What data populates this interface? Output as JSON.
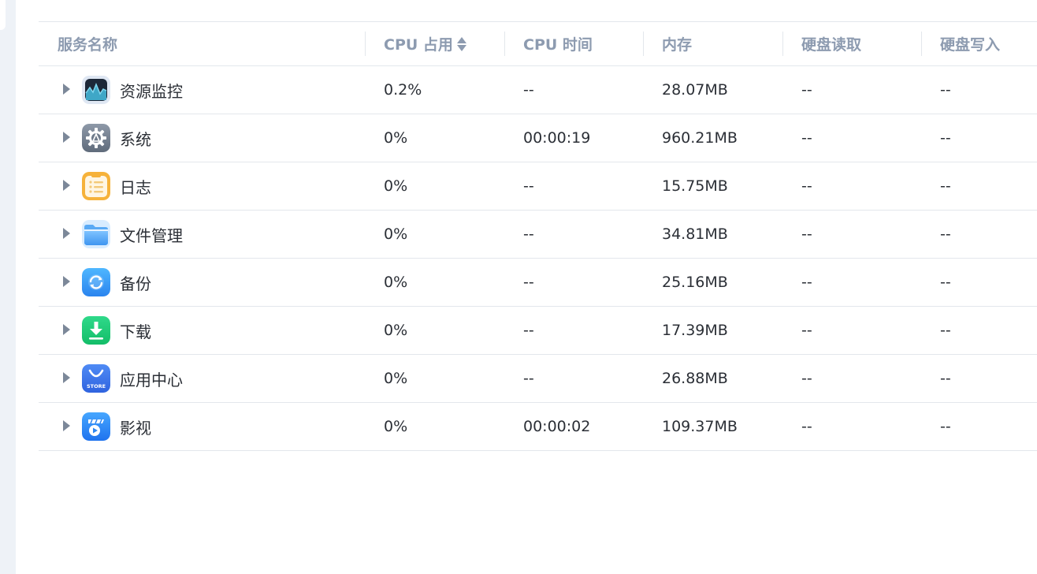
{
  "columns": {
    "name": "服务名称",
    "cpu_usage": "CPU 占用",
    "cpu_time": "CPU 时间",
    "memory": "内存",
    "disk_read": "硬盘读取",
    "disk_write": "硬盘写入"
  },
  "sort": {
    "column": "cpu_usage",
    "icon": "sort-updown-icon"
  },
  "colors": {
    "header_text": "#8d9bb0",
    "border": "#e3e7ec",
    "text": "#2b2f36",
    "sidebar_bg": "#eef2f7"
  },
  "rows": [
    {
      "name": "资源监控",
      "icon": "resource-monitor-icon",
      "cpu_usage": "0.2%",
      "cpu_time": "--",
      "memory": "28.07MB",
      "disk_read": "--",
      "disk_write": "--"
    },
    {
      "name": "系统",
      "icon": "system-gear-icon",
      "cpu_usage": "0%",
      "cpu_time": "00:00:19",
      "memory": "960.21MB",
      "disk_read": "--",
      "disk_write": "--"
    },
    {
      "name": "日志",
      "icon": "log-notepad-icon",
      "cpu_usage": "0%",
      "cpu_time": "--",
      "memory": "15.75MB",
      "disk_read": "--",
      "disk_write": "--"
    },
    {
      "name": "文件管理",
      "icon": "folder-icon",
      "cpu_usage": "0%",
      "cpu_time": "--",
      "memory": "34.81MB",
      "disk_read": "--",
      "disk_write": "--"
    },
    {
      "name": "备份",
      "icon": "backup-sync-icon",
      "cpu_usage": "0%",
      "cpu_time": "--",
      "memory": "25.16MB",
      "disk_read": "--",
      "disk_write": "--"
    },
    {
      "name": "下载",
      "icon": "download-icon",
      "cpu_usage": "0%",
      "cpu_time": "--",
      "memory": "17.39MB",
      "disk_read": "--",
      "disk_write": "--"
    },
    {
      "name": "应用中心",
      "icon": "app-store-icon",
      "cpu_usage": "0%",
      "cpu_time": "--",
      "memory": "26.88MB",
      "disk_read": "--",
      "disk_write": "--"
    },
    {
      "name": "影视",
      "icon": "video-icon",
      "cpu_usage": "0%",
      "cpu_time": "00:00:02",
      "memory": "109.37MB",
      "disk_read": "--",
      "disk_write": "--"
    }
  ],
  "icon_text": {
    "store_label": "STORE"
  }
}
